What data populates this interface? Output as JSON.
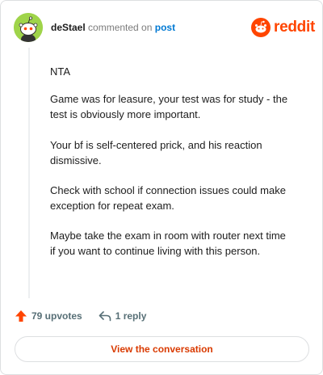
{
  "header": {
    "username": "deStael",
    "commented_on_text": "commented on",
    "post_link_text": "post",
    "logo_text": "reddit"
  },
  "comment": {
    "paragraphs": [
      "NTA",
      "Game was for leasure, your test was for study - the test is obviously more important.",
      "Your bf is self-centered prick, and his reaction dismissive.",
      "Check with school if connection issues could make exception for repeat exam.",
      "Maybe take the exam in room with router next time if you want to continue living with this person."
    ]
  },
  "actions": {
    "upvotes_label": "79 upvotes",
    "replies_label": "1 reply"
  },
  "footer": {
    "view_conversation_label": "View the conversation"
  },
  "colors": {
    "brand": "#ff4500",
    "link": "#0079d3",
    "button_text": "#d93a00",
    "avatar_bg": "#9fd44a"
  },
  "icons": [
    "snoo-avatar-icon",
    "reddit-logo-icon",
    "upvote-arrow-icon",
    "reply-arrow-icon"
  ]
}
